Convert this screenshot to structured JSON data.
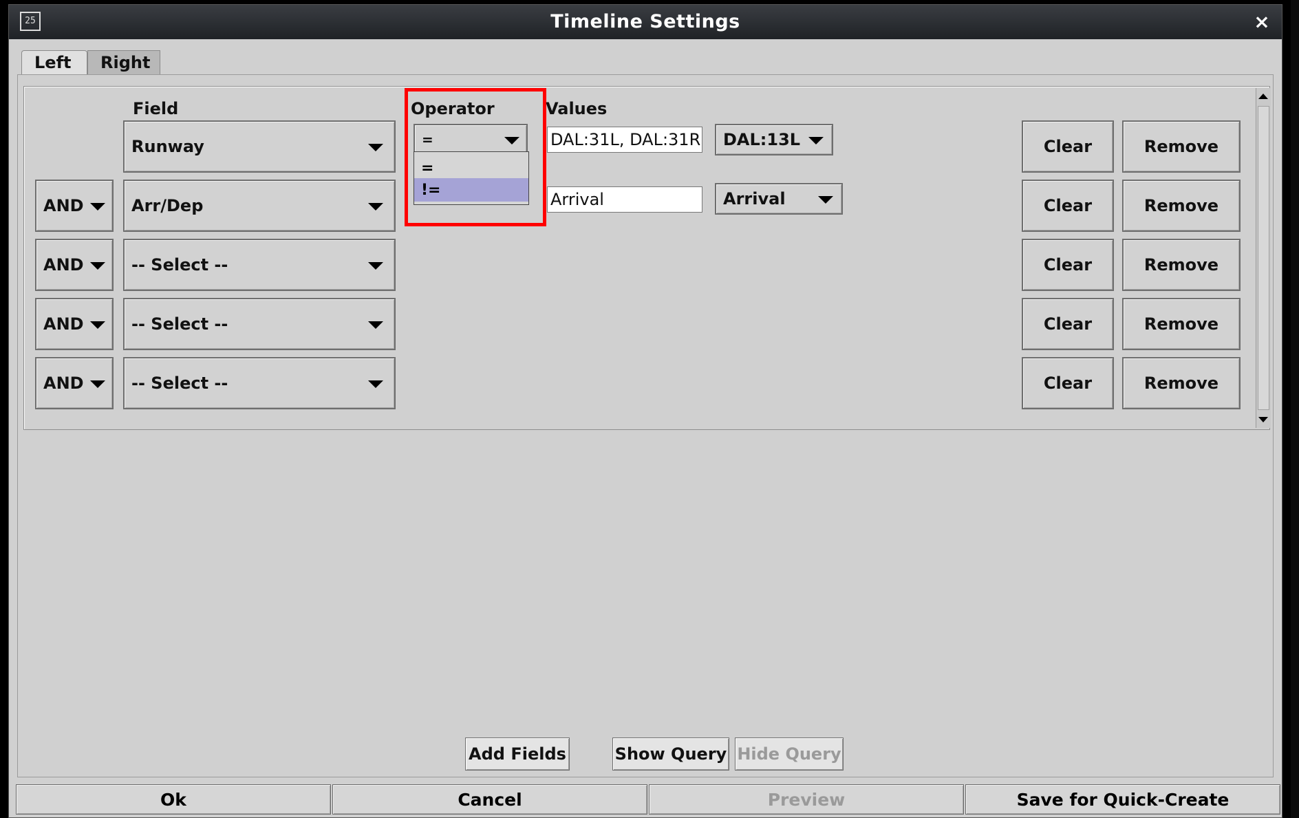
{
  "window": {
    "title": "Timeline Settings",
    "app_icon_text": "25",
    "close_symbol": "×"
  },
  "tabs": [
    {
      "label": "Left",
      "selected": true
    },
    {
      "label": "Right",
      "selected": false
    }
  ],
  "headers": {
    "field": "Field",
    "operator": "Operator",
    "values": "Values"
  },
  "rows": [
    {
      "conjunction": "",
      "field": "Runway",
      "operator": "=",
      "value_text": "DAL:31L, DAL:31R",
      "value_select": "DAL:13L",
      "clear": "Clear",
      "remove": "Remove"
    },
    {
      "conjunction": "AND",
      "field": "Arr/Dep",
      "operator": "",
      "value_text": "Arrival",
      "value_select": "Arrival",
      "clear": "Clear",
      "remove": "Remove"
    },
    {
      "conjunction": "AND",
      "field": "-- Select --",
      "clear": "Clear",
      "remove": "Remove"
    },
    {
      "conjunction": "AND",
      "field": "-- Select --",
      "clear": "Clear",
      "remove": "Remove"
    },
    {
      "conjunction": "AND",
      "field": "-- Select --",
      "clear": "Clear",
      "remove": "Remove"
    }
  ],
  "operator_dropdown": {
    "options": [
      "=",
      "!="
    ],
    "highlighted_index": 1
  },
  "actions": {
    "add_fields": "Add Fields",
    "show_query": "Show Query",
    "hide_query": "Hide Query"
  },
  "footer": {
    "ok": "Ok",
    "cancel": "Cancel",
    "preview": "Preview",
    "save_quick_create": "Save for Quick-Create"
  },
  "colors": {
    "highlight_border": "#ff0000",
    "dropdown_selection": "#a5a3d6",
    "dialog_bg": "#d0d0d0"
  }
}
